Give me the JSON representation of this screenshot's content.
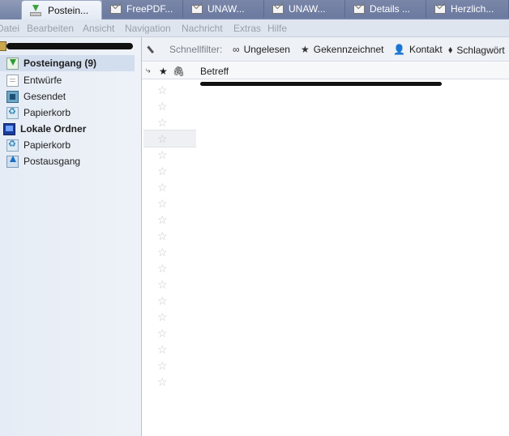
{
  "tabs": [
    {
      "label": "Postein...",
      "icon": "inbox-download-icon",
      "active": true
    },
    {
      "label": "FreePDF...",
      "icon": "envelope-icon"
    },
    {
      "label": "UNAW...",
      "icon": "envelope-icon"
    },
    {
      "label": "UNAW...",
      "icon": "envelope-icon"
    },
    {
      "label": "Details ...",
      "icon": "envelope-icon"
    },
    {
      "label": "Herzlich...",
      "icon": "envelope-icon"
    }
  ],
  "menu": [
    "Datei",
    "Bearbeiten",
    "Ansicht",
    "Navigation",
    "Nachricht",
    "Extras",
    "Hilfe"
  ],
  "sidebar": {
    "folders": [
      {
        "label": "Posteingang (9)",
        "icon": "inbox-icon",
        "bold": true,
        "selected": true
      },
      {
        "label": "Entwürfe",
        "icon": "drafts-icon"
      },
      {
        "label": "Gesendet",
        "icon": "sent-icon"
      },
      {
        "label": "Papierkorb",
        "icon": "trash-icon"
      },
      {
        "label": "Lokale Ordner",
        "icon": "local-folders-icon",
        "bold": true
      },
      {
        "label": "Papierkorb",
        "icon": "trash-icon"
      },
      {
        "label": "Postausgang",
        "icon": "outbox-icon"
      }
    ]
  },
  "quickfilter": {
    "label": "Schnellfilter:",
    "buttons": [
      "Ungelesen",
      "Gekennzeichnet",
      "Kontakt",
      "Schlagwört"
    ]
  },
  "threadlist": {
    "subject_header": "Betreff"
  }
}
